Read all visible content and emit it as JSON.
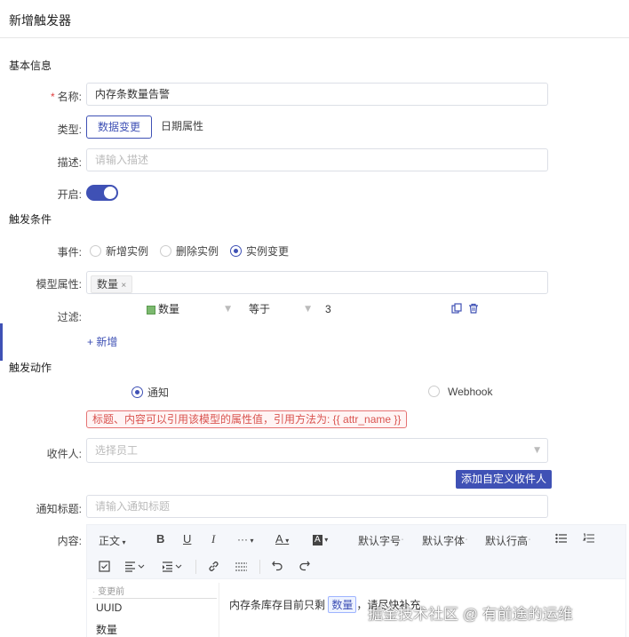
{
  "header": {
    "title": "新增触发器"
  },
  "sections": {
    "basic": "基本信息",
    "condition": "触发条件",
    "action": "触发动作"
  },
  "form": {
    "name_label": "名称:",
    "name_required": "*",
    "name_value": "内存条数量告警",
    "type_label": "类型:",
    "type_options": [
      "数据变更",
      "日期属性"
    ],
    "type_selected": "数据变更",
    "desc_label": "描述:",
    "desc_placeholder": "请输入描述",
    "enable_label": "开启:",
    "enabled": true
  },
  "condition": {
    "event_label": "事件:",
    "events": [
      "新增实例",
      "删除实例",
      "实例变更"
    ],
    "event_selected": "实例变更",
    "model_attr_label": "模型属性:",
    "model_attr_tag": "数量",
    "tag_close": "×",
    "filter_label": "过滤:",
    "filter": {
      "field": "数量",
      "operator": "等于",
      "value": "3"
    },
    "add_label": "+ 新增"
  },
  "action": {
    "types": [
      "通知",
      "Webhook"
    ],
    "type_selected": "通知",
    "hint": "标题、内容可以引用该模型的属性值，引用方法为: {{ attr_name }}",
    "recipient_label": "收件人:",
    "recipient_placeholder": "选择员工",
    "add_custom_recipient": "添加自定义收件人",
    "notify_title_label": "通知标题:",
    "notify_title_placeholder": "请输入通知标题",
    "content_label": "内容:"
  },
  "editor": {
    "toolbar": {
      "paragraph": "正文",
      "bold": "B",
      "underline": "U",
      "italic": "I",
      "more": "···",
      "font_color": "A",
      "bg_color": "A",
      "font_size": "默认字号",
      "font_family": "默认字体",
      "line_height": "默认行高"
    },
    "var_panel": {
      "header": "变更前",
      "items": [
        "UUID",
        "数量"
      ]
    },
    "content_prefix": "内存条库存目前只剩",
    "content_var": "数量",
    "content_suffix": "，请尽快补充"
  },
  "watermark": "掘金技术社区 @ 有前途的运维"
}
